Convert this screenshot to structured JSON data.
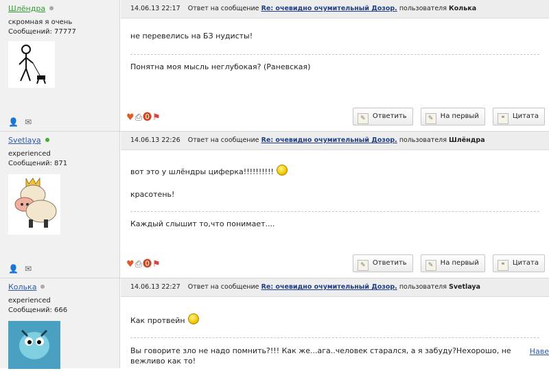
{
  "posts": [
    {
      "author": {
        "name": "Шлёндра",
        "status": "offline",
        "rank": "скромная я очень",
        "count_label": "Сообщений: 77777"
      },
      "header": {
        "date": "14.06.13 22:17",
        "prefix": "Ответ на сообщение",
        "link": "Re: очевидно очумительный Дозор.",
        "by": "пользователя",
        "user": "Колька"
      },
      "body": [
        "не перевелись на БЗ нудисты!"
      ],
      "signature": "Понятна моя мысль неглубокая? (Раневская)"
    },
    {
      "author": {
        "name": "Svetlaya",
        "status": "online",
        "rank": "experienced",
        "count_label": "Сообщений: 871"
      },
      "header": {
        "date": "14.06.13 22:26",
        "prefix": "Ответ на сообщение",
        "link": "Re: очевидно очумительный Дозор.",
        "by": "пользователя",
        "user": "Шлёндра"
      },
      "body": [
        "вот это у шлёндры циферка!!!!!!!!!!",
        "красотень!"
      ],
      "signature": "Каждый слышит то,что понимает...."
    },
    {
      "author": {
        "name": "Колька",
        "status": "offline",
        "rank": "experienced",
        "count_label": "Сообщений: 666"
      },
      "header": {
        "date": "14.06.13 22:27",
        "prefix": "Ответ на сообщение",
        "link": "Re: очевидно очумительный Дозор.",
        "by": "пользователя",
        "user": "Svetlaya"
      },
      "body": [
        "Как протвейн"
      ],
      "signature": "Вы говорите зло не надо помнить?!!! Как же...ага..человек старался, а я забуду?Нехорошо, не вежливо как то!"
    }
  ],
  "buttons": {
    "reply": "Ответить",
    "to_first": "На первый",
    "quote": "Цитата"
  },
  "side_link": "Наве",
  "icons": {
    "heart": "heart-icon",
    "print": "printer-icon",
    "warn": "warning-icon",
    "flag": "flag-icon",
    "profile": "user-profile-icon",
    "mail": "mail-icon"
  }
}
